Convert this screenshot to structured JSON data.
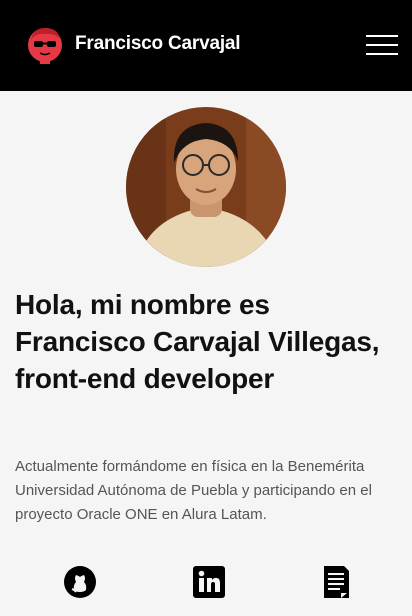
{
  "header": {
    "brand": "Francisco Carvajal",
    "logo_icon": "red-face-avatar-icon",
    "menu_icon": "hamburger-menu-icon"
  },
  "profile": {
    "avatar_alt": "profile-photo"
  },
  "hero": {
    "headline": "Hola, mi nombre es Francisco Carvajal Villegas, front-end developer",
    "bio": "Actualmente formándome en física en la Benemérita Universidad Autónoma de Puebla y participando en el proyecto Oracle ONE en Alura Latam."
  },
  "social": [
    {
      "icon": "github-icon"
    },
    {
      "icon": "linkedin-icon"
    },
    {
      "icon": "document-icon"
    }
  ],
  "colors": {
    "header_bg": "#000000",
    "page_bg": "#f5f5f5",
    "logo_red": "#e63946",
    "headline": "#111111",
    "body_text": "#555555"
  }
}
